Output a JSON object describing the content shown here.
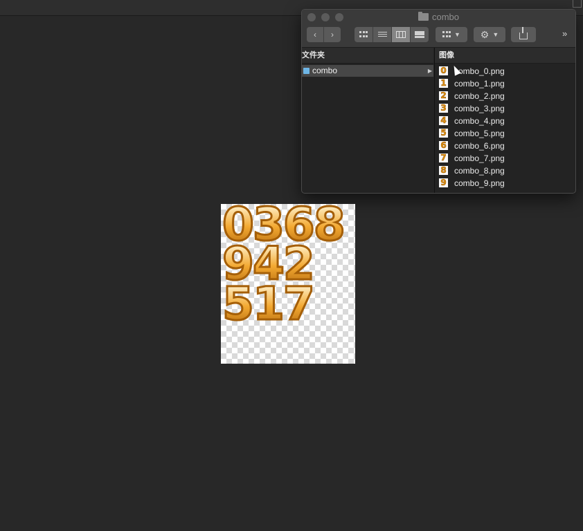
{
  "finder": {
    "title": "combo",
    "column_headers": {
      "folders": "文件夹",
      "images": "图像"
    },
    "folder": {
      "name": "combo"
    },
    "files": [
      {
        "thumb": "0",
        "name": "combo_0.png"
      },
      {
        "thumb": "1",
        "name": "combo_1.png"
      },
      {
        "thumb": "2",
        "name": "combo_2.png"
      },
      {
        "thumb": "3",
        "name": "combo_3.png"
      },
      {
        "thumb": "4",
        "name": "combo_4.png"
      },
      {
        "thumb": "5",
        "name": "combo_5.png"
      },
      {
        "thumb": "6",
        "name": "combo_6.png"
      },
      {
        "thumb": "7",
        "name": "combo_7.png"
      },
      {
        "thumb": "8",
        "name": "combo_8.png"
      },
      {
        "thumb": "9",
        "name": "combo_9.png"
      }
    ],
    "more_label": "»"
  },
  "preview": {
    "rows": [
      [
        "0",
        "3",
        "6",
        "8"
      ],
      [
        "9",
        "4",
        "2"
      ],
      [
        "5",
        "1",
        "7"
      ]
    ]
  },
  "colors": {
    "digit_fill": "#f5b449",
    "digit_stroke": "#a55f08",
    "folder_accent": "#6eb6e6"
  }
}
